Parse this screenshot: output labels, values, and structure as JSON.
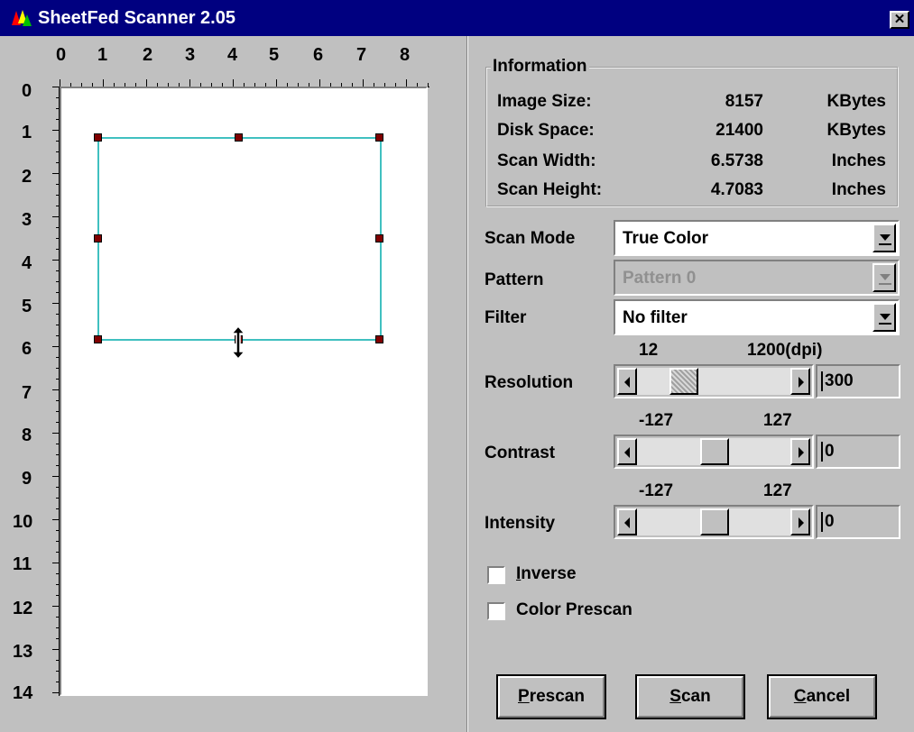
{
  "window": {
    "title": "SheetFed Scanner 2.05"
  },
  "ruler": {
    "top": [
      "0",
      "1",
      "2",
      "3",
      "4",
      "5",
      "6",
      "7",
      "8"
    ],
    "left": [
      "0",
      "1",
      "2",
      "3",
      "4",
      "5",
      "6",
      "7",
      "8",
      "9",
      "10",
      "11",
      "12",
      "13",
      "14"
    ]
  },
  "info": {
    "legend": "Information",
    "rows": [
      {
        "label": "Image Size:",
        "value": "8157",
        "unit": "KBytes"
      },
      {
        "label": "Disk Space:",
        "value": "21400",
        "unit": "KBytes"
      },
      {
        "label": "Scan Width:",
        "value": "6.5738",
        "unit": "Inches"
      },
      {
        "label": "Scan Height:",
        "value": "4.7083",
        "unit": "Inches"
      }
    ]
  },
  "scan_mode": {
    "label": "Scan Mode",
    "value": "True Color"
  },
  "pattern": {
    "label": "Pattern",
    "value": "Pattern 0"
  },
  "filter": {
    "label": "Filter",
    "value": "No filter"
  },
  "resolution": {
    "label": "Resolution",
    "min": "12",
    "max": "1200(dpi)",
    "value": "300"
  },
  "contrast": {
    "label": "Contrast",
    "min": "-127",
    "max": "127",
    "value": "0"
  },
  "intensity": {
    "label": "Intensity",
    "min": "-127",
    "max": "127",
    "value": "0"
  },
  "options": {
    "inverse": {
      "accel": "I",
      "rest": "nverse"
    },
    "color_prescan": {
      "label": "Color Prescan"
    }
  },
  "buttons": {
    "prescan": {
      "accel": "P",
      "rest": "rescan"
    },
    "scan": {
      "accel": "S",
      "rest": "can"
    },
    "cancel": {
      "accel": "C",
      "rest": "ancel"
    }
  }
}
